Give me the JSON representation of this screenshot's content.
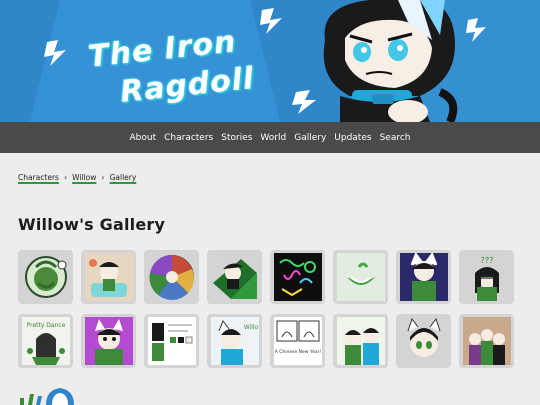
{
  "banner": {
    "title_line_1": "The Iron",
    "title_line_2": "Ragdoll"
  },
  "nav": {
    "items": [
      "About",
      "Characters",
      "Stories",
      "World",
      "Gallery",
      "Updates",
      "Search"
    ]
  },
  "breadcrumb": {
    "items": [
      "Characters",
      "Willow",
      "Gallery"
    ],
    "separator": "›"
  },
  "page": {
    "title": "Willow's Gallery"
  },
  "gallery": {
    "thumb_count": 16,
    "thumb_5_text": "Pretty Dance",
    "thumb_8_text": "???",
    "thumb_13_text": "Willo",
    "thumb_15_text": "A Chinese New Year!"
  },
  "colors": {
    "banner_blue": "#2f86c9",
    "nav_bg": "#4a4a4a",
    "page_bg": "#ededed",
    "thumb_bg": "#d4d4d4",
    "breadcrumb_underline": "#22a033",
    "title_glow": "#22b8d6"
  }
}
